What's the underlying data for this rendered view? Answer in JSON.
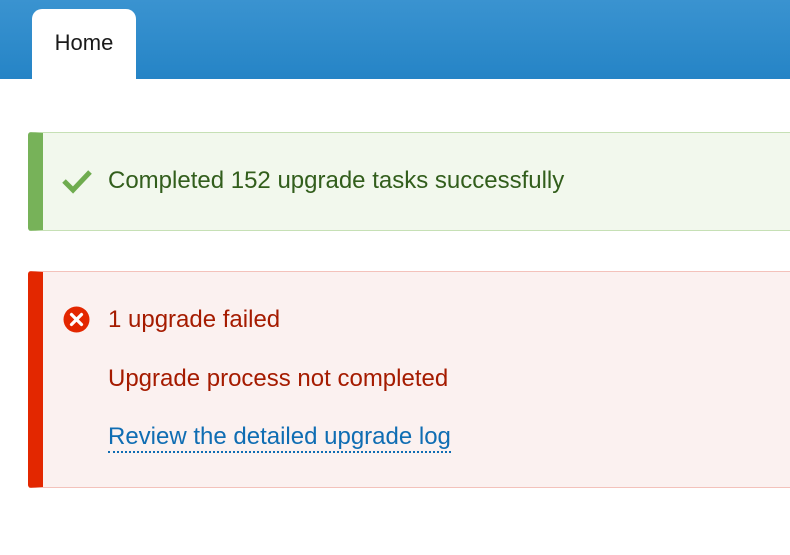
{
  "tabs": [
    {
      "label": "Home",
      "active": true
    }
  ],
  "messages": {
    "success": {
      "icon": "checkmark-icon",
      "text": "Completed 152 upgrade tasks successfully",
      "accent_color": "#77b259"
    },
    "error": {
      "icon": "error-x-icon",
      "title": "1 upgrade failed",
      "subtitle": "Upgrade process not completed",
      "link_text": "Review the detailed upgrade log",
      "accent_color": "#e32700"
    }
  },
  "colors": {
    "header": "#2584c6",
    "link": "#0f6db3"
  }
}
